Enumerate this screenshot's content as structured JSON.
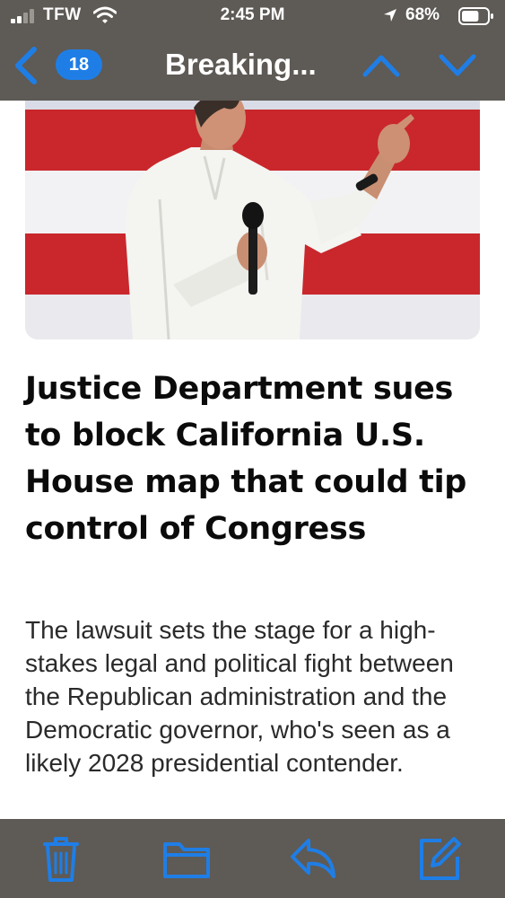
{
  "status_bar": {
    "carrier": "TFW",
    "time": "2:45 PM",
    "battery_percent": "68%",
    "signal_bars": 2,
    "battery_level": 0.68
  },
  "nav": {
    "back_icon": "chevron-left-icon",
    "unread_count": "18",
    "title": "Breaking...",
    "prev_icon": "chevron-up-icon",
    "next_icon": "chevron-down-icon",
    "accent_color": "#1f7ee6",
    "bar_color": "#5e5a55"
  },
  "article": {
    "hero_image": "photo of speaker in white shirt holding microphone in front of red-and-white striped flag",
    "headline": "Justice Department sues to block California U.S. House map that could tip control of Congress",
    "summary": "The lawsuit sets the stage for a high-stakes legal and political fight between the Republican administration and the Democratic governor, who's seen as a likely 2028 presidential contender."
  },
  "toolbar": {
    "items": [
      "trash-icon",
      "folder-icon",
      "reply-icon",
      "compose-icon"
    ]
  }
}
